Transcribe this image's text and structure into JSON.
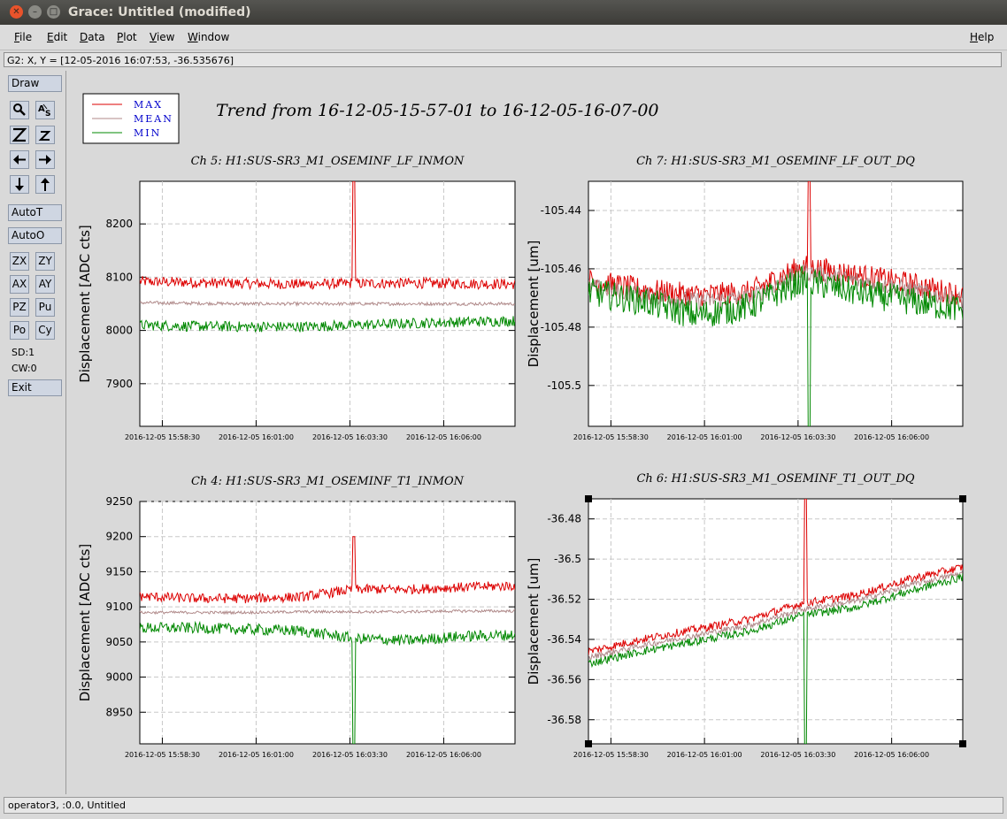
{
  "window": {
    "title": "Grace: Untitled (modified)"
  },
  "menu": {
    "left": [
      "File",
      "Edit",
      "Data",
      "Plot",
      "View",
      "Window"
    ],
    "help": "Help"
  },
  "locator": "G2: X, Y = [12-05-2016 16:07:53, -36.535676]",
  "toolbar": {
    "draw": "Draw",
    "autot": "AutoT",
    "autoo": "AutoO",
    "zx": "ZX",
    "zy": "ZY",
    "ax": "AX",
    "ay": "AY",
    "pz": "PZ",
    "pu": "Pu",
    "po": "Po",
    "cy": "Cy",
    "sd": "SD:1",
    "cw": "CW:0",
    "exit": "Exit",
    "icons": [
      "zoom-icon",
      "autoscale-text-icon",
      "zoom-in-icon",
      "zoom-out-icon",
      "left-arrow-icon",
      "right-arrow-icon",
      "down-arrow-icon",
      "up-arrow-icon"
    ]
  },
  "status": "operator3, :0.0, Untitled",
  "plot": {
    "main_title": "Trend from 16-12-05-15-57-01 to 16-12-05-16-07-00",
    "legend": [
      {
        "label": "MAX",
        "color": "#dd0000"
      },
      {
        "label": "MEAN",
        "color": "#b08a8a"
      },
      {
        "label": "MIN",
        "color": "#008800"
      }
    ],
    "legend_text_color": "#0000cc"
  },
  "chart_data": [
    {
      "type": "line",
      "title": "Ch 5: H1:SUS-SR3_M1_OSEMINF_LF_INMON",
      "ylabel": "Displacement [ADC cts]",
      "ylim": [
        7820,
        8280
      ],
      "yticks": [
        7900,
        8000,
        8100,
        8200
      ],
      "xticks": [
        "2016-12-05 15:58:30",
        "2016-12-05 16:01:00",
        "2016-12-05 16:03:30",
        "2016-12-05 16:06:00"
      ],
      "series": [
        {
          "name": "MAX",
          "color": "#dd0000",
          "level": [
            8092,
            8090,
            8088,
            8087,
            8088,
            8089,
            8088,
            8087
          ],
          "noise": 10,
          "spike": {
            "t": 0.57,
            "value": 8280
          }
        },
        {
          "name": "MEAN",
          "color": "#b08a8a",
          "level": [
            8052,
            8051,
            8050,
            8050,
            8050,
            8050,
            8050,
            8050
          ],
          "noise": 3
        },
        {
          "name": "MIN",
          "color": "#008800",
          "level": [
            8010,
            8008,
            8007,
            8007,
            8010,
            8013,
            8016,
            8018
          ],
          "noise": 10
        }
      ]
    },
    {
      "type": "line",
      "title": "Ch 7: H1:SUS-SR3_M1_OSEMINF_LF_OUT_DQ",
      "ylabel": "Displacement [um]",
      "ylim": [
        -105.514,
        -105.43
      ],
      "yticks": [
        -105.5,
        -105.48,
        -105.46,
        -105.44
      ],
      "xticks": [
        "2016-12-05 15:58:30",
        "2016-12-05 16:01:00",
        "2016-12-05 16:03:30",
        "2016-12-05 16:06:00"
      ],
      "series": [
        {
          "name": "MAX",
          "color": "#dd0000",
          "level": [
            -105.464,
            -105.467,
            -105.469,
            -105.468,
            -105.459,
            -105.462,
            -105.465,
            -105.469
          ],
          "noise": 0.004,
          "spike": {
            "t": 0.59,
            "value": -105.43
          }
        },
        {
          "name": "MEAN",
          "color": "#b08a8a",
          "level": [
            -105.466,
            -105.469,
            -105.471,
            -105.47,
            -105.461,
            -105.464,
            -105.467,
            -105.471
          ],
          "noise": 0.003
        },
        {
          "name": "MIN",
          "color": "#008800",
          "level": [
            -105.468,
            -105.471,
            -105.476,
            -105.473,
            -105.464,
            -105.468,
            -105.471,
            -105.474
          ],
          "noise": 0.005,
          "spike": {
            "t": 0.59,
            "value": -105.514
          }
        }
      ]
    },
    {
      "type": "line",
      "title": "Ch 4: H1:SUS-SR3_M1_OSEMINF_T1_INMON",
      "ylabel": "Displacement [ADC cts]",
      "ylim": [
        8905,
        9250
      ],
      "yticks": [
        8950,
        9000,
        9050,
        9100,
        9150,
        9200,
        9250
      ],
      "xticks": [
        "2016-12-05 15:58:30",
        "2016-12-05 16:01:00",
        "2016-12-05 16:03:30",
        "2016-12-05 16:06:00"
      ],
      "series": [
        {
          "name": "MAX",
          "color": "#dd0000",
          "level": [
            9115,
            9112,
            9112,
            9114,
            9125,
            9125,
            9128,
            9130
          ],
          "noise": 7,
          "spike": {
            "t": 0.57,
            "value": 9200
          }
        },
        {
          "name": "MEAN",
          "color": "#b08a8a",
          "level": [
            9092,
            9092,
            9092,
            9093,
            9093,
            9093,
            9094,
            9094
          ],
          "noise": 2
        },
        {
          "name": "MIN",
          "color": "#008800",
          "level": [
            9070,
            9070,
            9068,
            9066,
            9055,
            9052,
            9058,
            9060
          ],
          "noise": 8,
          "spike": {
            "t": 0.57,
            "value": 8905
          }
        }
      ]
    },
    {
      "type": "line",
      "title": "Ch 6: H1:SUS-SR3_M1_OSEMINF_T1_OUT_DQ",
      "ylabel": "Displacement [um]",
      "ylim": [
        -36.592,
        -36.47
      ],
      "yticks": [
        -36.58,
        -36.56,
        -36.54,
        -36.52,
        -36.5,
        -36.48
      ],
      "xticks": [
        "2016-12-05 15:58:30",
        "2016-12-05 16:01:00",
        "2016-12-05 16:03:30",
        "2016-12-05 16:06:00"
      ],
      "series": [
        {
          "name": "MAX",
          "color": "#dd0000",
          "level": [
            -36.546,
            -36.54,
            -36.535,
            -36.53,
            -36.522,
            -36.518,
            -36.51,
            -36.504
          ],
          "noise": 0.002,
          "spike": {
            "t": 0.58,
            "value": -36.47
          }
        },
        {
          "name": "MEAN",
          "color": "#b08a8a",
          "level": [
            -36.549,
            -36.543,
            -36.538,
            -36.533,
            -36.525,
            -36.521,
            -36.513,
            -36.507
          ],
          "noise": 0.0015
        },
        {
          "name": "MIN",
          "color": "#008800",
          "level": [
            -36.552,
            -36.546,
            -36.541,
            -36.536,
            -36.528,
            -36.524,
            -36.516,
            -36.509
          ],
          "noise": 0.002,
          "spike": {
            "t": 0.58,
            "value": -36.592
          }
        }
      ]
    }
  ]
}
